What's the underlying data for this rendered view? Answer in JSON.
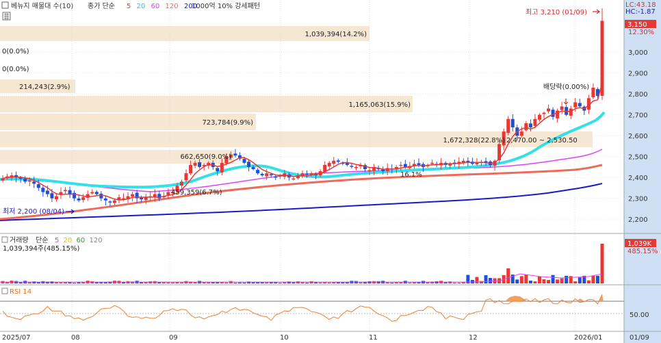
{
  "header": {
    "menu_label": "베뉴지 매물대 수(10)",
    "ma_title": "종가 단순",
    "ma_periods": [
      "5",
      "20",
      "60",
      "120",
      "200"
    ],
    "ma_colors": [
      "#e53935",
      "#26c6da",
      "#e040fb",
      "#f06a5a",
      "#1a1acc"
    ],
    "pattern_label": "1000억 10% 강세패턴"
  },
  "right_top": {
    "lc": "LC:43.18",
    "hc": "HC:-1.87"
  },
  "price_axis": {
    "ticks": [
      3000,
      2900,
      2800,
      2700,
      2600,
      2500,
      2400,
      2300,
      2200
    ],
    "tick_labels": [
      "3,000",
      "2,900",
      "2,800",
      "2,700",
      "2,600",
      "2,500",
      "2,400",
      "2,300",
      "2,200"
    ],
    "range": [
      2135,
      3250
    ],
    "current_price": "3,150",
    "current_pct": "12.30%"
  },
  "annotations": {
    "high": "최고 3,210 (01/09)",
    "low": "최저 2,200 (08/04)",
    "dividend": "배당락(0.00%)",
    "range_box": "2,470.00 ~ 2,530.50",
    "range_pct": "16.1%"
  },
  "volume_profile": [
    {
      "label": "1,039,394(14.2%)"
    },
    {
      "label": "0(0.0%)"
    },
    {
      "label": "0(0.0%)"
    },
    {
      "label": "214,243(2.9%)"
    },
    {
      "label": "1,165,063(15.9%)"
    },
    {
      "label": "723,784(9.9%)"
    },
    {
      "label": "1,672,328(22.8%)"
    },
    {
      "label": "662,650(9.0%)"
    },
    {
      "label": "459,359(6.7%)"
    }
  ],
  "volume_panel": {
    "title": "거래량",
    "ma_title": "단순",
    "ma_periods": [
      "5",
      "20",
      "60",
      "120"
    ],
    "ma_colors": [
      "#e040fb",
      "#f0c000",
      "#2e9e2e",
      "#888888"
    ],
    "value_label": "1,039,394주(485.15%)",
    "right_value": "1,039K",
    "right_pct": "485.15%"
  },
  "rsi_panel": {
    "title": "RSI 14",
    "level_label": "50.00"
  },
  "time_axis": {
    "labels": [
      "2025/07",
      "08",
      "09",
      "10",
      "11",
      "12",
      "2026/01",
      "01/09"
    ]
  },
  "chart_data": {
    "type": "candlestick",
    "x_range": [
      "2025/07",
      "2026/01/09"
    ],
    "ylim": [
      2135,
      3250
    ],
    "high": 3210,
    "low": 2200,
    "last_close": 3150,
    "last_change_pct": 12.3,
    "last_volume": 1039394,
    "last_volume_pct": 485.15,
    "closes": [
      2395,
      2405,
      2410,
      2400,
      2395,
      2380,
      2385,
      2370,
      2350,
      2330,
      2320,
      2300,
      2310,
      2330,
      2340,
      2320,
      2300,
      2290,
      2305,
      2320,
      2330,
      2320,
      2300,
      2290,
      2280,
      2290,
      2305,
      2300,
      2310,
      2320,
      2300,
      2295,
      2305,
      2310,
      2320,
      2300,
      2310,
      2330,
      2330,
      2360,
      2380,
      2420,
      2460,
      2470,
      2450,
      2460,
      2470,
      2450,
      2430,
      2470,
      2500,
      2510,
      2505,
      2490,
      2470,
      2450,
      2440,
      2420,
      2410,
      2420,
      2410,
      2400,
      2410,
      2420,
      2400,
      2395,
      2410,
      2420,
      2415,
      2420,
      2410,
      2430,
      2460,
      2470,
      2480,
      2475,
      2470,
      2460,
      2455,
      2450,
      2460,
      2440,
      2435,
      2450,
      2440,
      2430,
      2445,
      2440,
      2450,
      2460,
      2450,
      2455,
      2465,
      2460,
      2450,
      2460,
      2470,
      2465,
      2470,
      2460,
      2465,
      2470,
      2475,
      2480,
      2470,
      2465,
      2470,
      2475,
      2470,
      2460,
      2480,
      2560,
      2620,
      2680,
      2640,
      2600,
      2620,
      2660,
      2640,
      2680,
      2700,
      2710,
      2730,
      2690,
      2720,
      2740,
      2700,
      2730,
      2760,
      2740,
      2720,
      2780,
      2830,
      2790,
      3150
    ],
    "volume_values": [
      1039394
    ]
  }
}
